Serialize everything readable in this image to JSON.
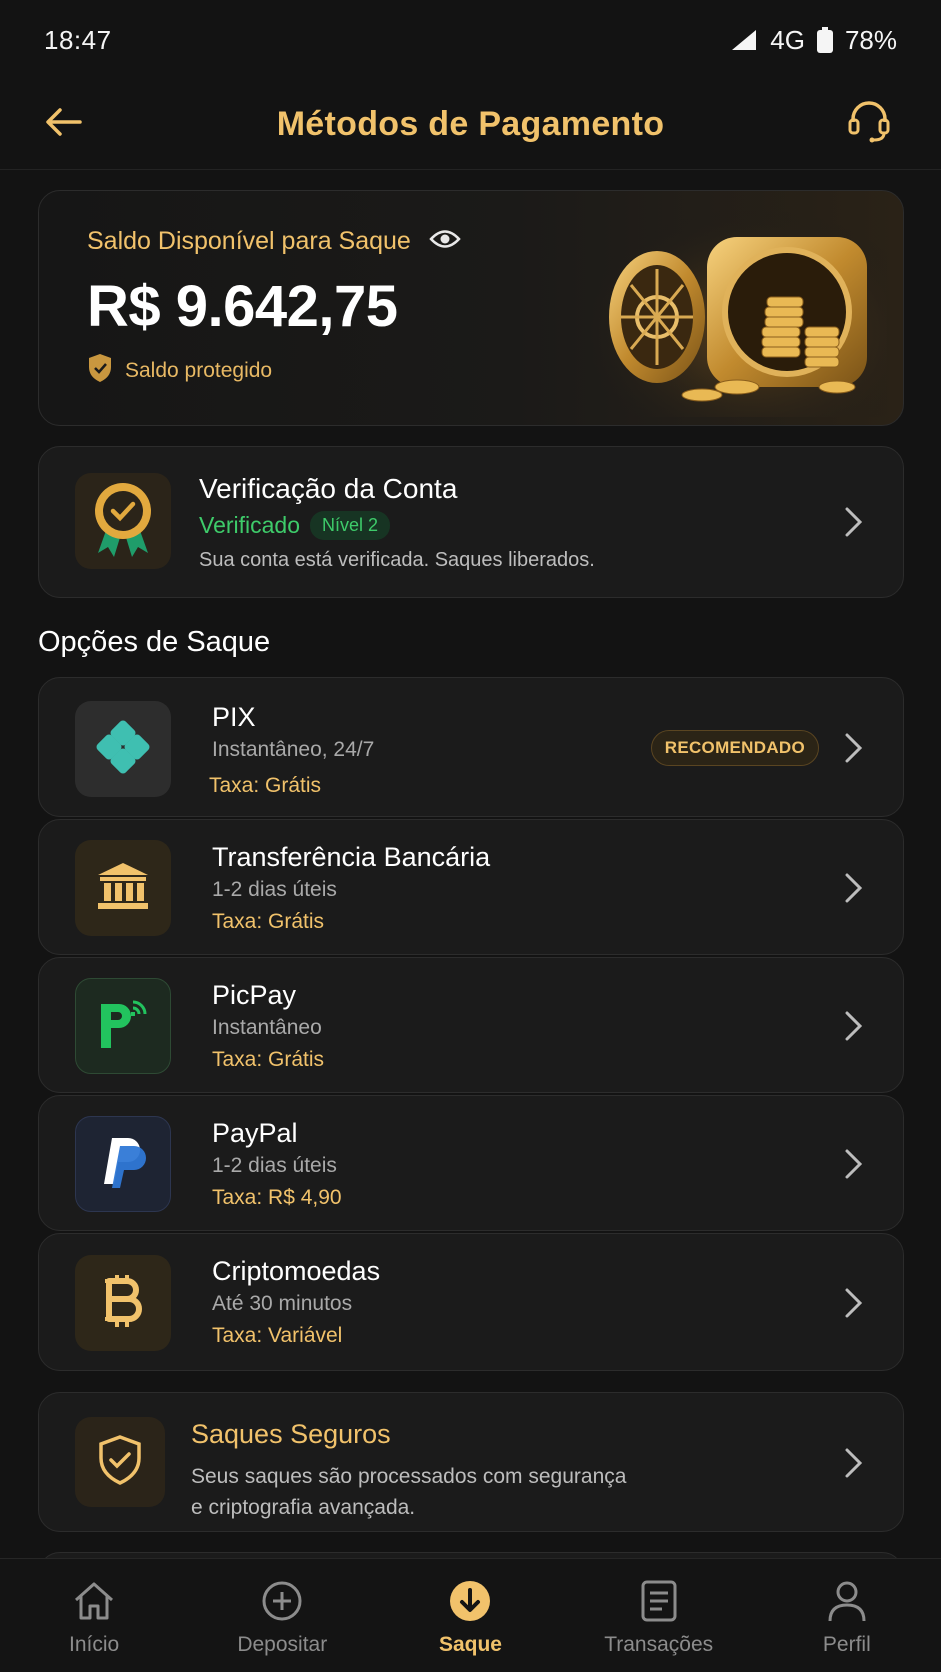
{
  "status_bar": {
    "time": "18:47",
    "network": "4G",
    "battery": "78%"
  },
  "header": {
    "title": "Métodos de Pagamento",
    "back_icon": "arrow-left-icon",
    "support_icon": "headset-icon"
  },
  "balance": {
    "label": "Saldo Disponível para Saque",
    "amount": "R$ 9.642,75",
    "protected_label": "Saldo protegido"
  },
  "verification": {
    "title": "Verificação da Conta",
    "status": "Verificado",
    "level": "Nível 2",
    "description": "Sua conta está verificada. Saques liberados."
  },
  "options_section": {
    "title": "Opções de Saque"
  },
  "options": [
    {
      "name": "PIX",
      "time": "Instantâneo, 24/7",
      "fee": "Taxa: Grátis",
      "badge": "RECOMENDADO",
      "icon": "pix-icon"
    },
    {
      "name": "Transferência Bancária",
      "time": "1-2 dias úteis",
      "fee": "Taxa: Grátis",
      "icon": "bank-icon"
    },
    {
      "name": "PicPay",
      "time": "Instantâneo",
      "fee": "Taxa: Grátis",
      "icon": "picpay-icon"
    },
    {
      "name": "PayPal",
      "time": "1-2 dias úteis",
      "fee": "Taxa: R$ 4,90",
      "icon": "paypal-icon"
    },
    {
      "name": "Criptomoedas",
      "time": "Até 30 minutos",
      "fee": "Taxa: Variável",
      "icon": "bitcoin-icon"
    }
  ],
  "secure": {
    "title": "Saques Seguros",
    "line1": "Seus saques são processados com segurança",
    "line2": "e criptografia avançada."
  },
  "nav": [
    {
      "label": "Início",
      "icon": "home-icon"
    },
    {
      "label": "Depositar",
      "icon": "plus-circle-icon"
    },
    {
      "label": "Saque",
      "icon": "download-circle-icon",
      "active": true
    },
    {
      "label": "Transações",
      "icon": "document-icon"
    },
    {
      "label": "Perfil",
      "icon": "user-icon"
    }
  ],
  "colors": {
    "accent": "#f1c26b",
    "success": "#3ecb6a",
    "background": "#131313",
    "card": "#1b1b1b"
  }
}
